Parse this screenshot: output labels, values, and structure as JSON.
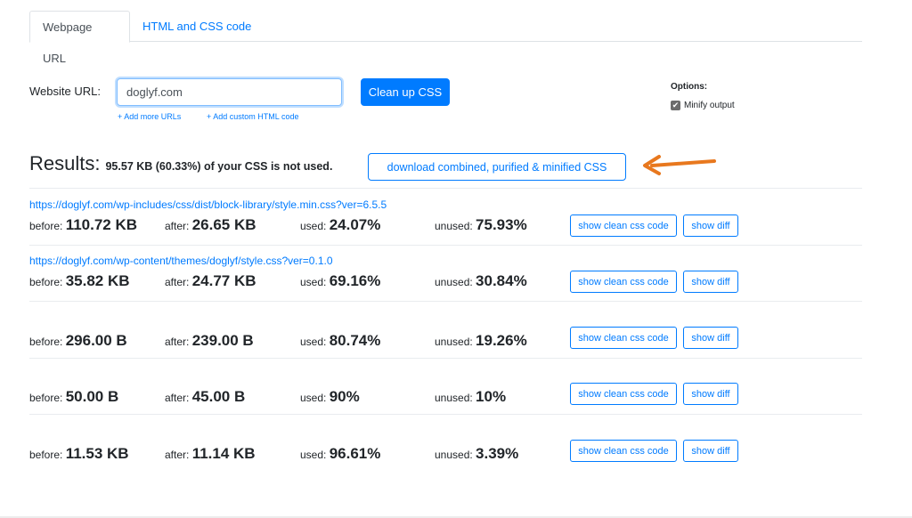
{
  "tabs": [
    {
      "label": "Webpage URL",
      "active": true
    },
    {
      "label": "HTML and CSS code",
      "active": false
    }
  ],
  "form": {
    "url_label": "Website URL:",
    "url_value": "doglyf.com",
    "submit_label": "Clean up CSS",
    "add_more_urls": "+ Add more URLs",
    "add_custom_html": "+ Add custom HTML code"
  },
  "options": {
    "title": "Options:",
    "minify_label": "Minify output",
    "minify_checked": true,
    "check_glyph": "✔"
  },
  "results": {
    "title": "Results:",
    "summary": "95.57 KB (60.33%) of your CSS is not used.",
    "download_label": "download combined, purified & minified CSS",
    "annotation_arrow_color": "#e8781e"
  },
  "labels": {
    "before": "before:",
    "after": "after:",
    "used": "used:",
    "unused": "unused:",
    "show_clean": "show clean css code",
    "show_diff": "show diff"
  },
  "rows": [
    {
      "url": "https://doglyf.com/wp-includes/css/dist/block-library/style.min.css?ver=6.5.5",
      "before": "110.72 KB",
      "after": "26.65 KB",
      "used": "24.07%",
      "unused": "75.93%"
    },
    {
      "url": "https://doglyf.com/wp-content/themes/doglyf/style.css?ver=0.1.0",
      "before": "35.82 KB",
      "after": "24.77 KB",
      "used": "69.16%",
      "unused": "30.84%"
    },
    {
      "url": "",
      "before": "296.00 B",
      "after": "239.00 B",
      "used": "80.74%",
      "unused": "19.26%"
    },
    {
      "url": "",
      "before": "50.00 B",
      "after": "45.00 B",
      "used": "90%",
      "unused": "10%"
    },
    {
      "url": "",
      "before": "11.53 KB",
      "after": "11.14 KB",
      "used": "96.61%",
      "unused": "3.39%"
    }
  ],
  "colors": {
    "primary": "#007bff",
    "text": "#212529",
    "divider": "#e9ecef"
  }
}
